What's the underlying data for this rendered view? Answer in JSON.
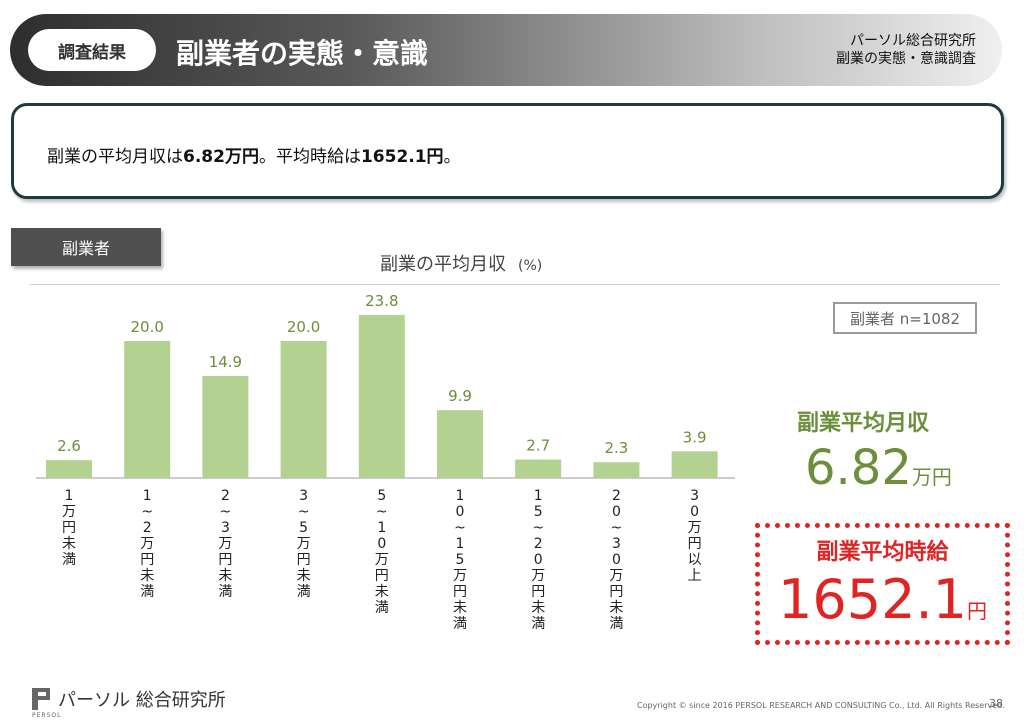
{
  "header": {
    "tag": "調査結果",
    "title": "副業者の実態・意識",
    "source_line1": "パーソル総合研究所",
    "source_line2": "副業の実態・意識調査"
  },
  "summary": {
    "prefix1": "副業の平均月収は",
    "value1": "6.82万円",
    "mid": "。平均時給は",
    "value2": "1652.1円",
    "suffix": "。"
  },
  "segment_label": "副業者",
  "sample_size": "副業者 n=1082",
  "avg_monthly": {
    "label": "副業平均月収",
    "value": "6.82",
    "unit": "万円"
  },
  "avg_hourly": {
    "label": "副業平均時給",
    "value": "1652.1",
    "unit": "円"
  },
  "footer": {
    "logo_text": "パーソル 総合研究所",
    "logo_sub": "PERSOL",
    "copyright": "Copyright © since 2016 PERSOL RESEARCH AND CONSULTING Co., Ltd. All Rights Reserved.",
    "page": "38"
  },
  "colors": {
    "bar": "#b3d190",
    "label": "#6b8f3a",
    "accent_red": "#e02424"
  },
  "chart_data": {
    "type": "bar",
    "title": "副業の平均月収",
    "unit": "(%)",
    "categories": [
      "1万円未満",
      "1~2万円未満",
      "2~3万円未満",
      "3~5万円未満",
      "5~10万円未満",
      "10~15万円未満",
      "15~20万円未満",
      "20~30万円未満",
      "30万円以上"
    ],
    "category_chars": [
      [
        "1",
        "万",
        "円",
        "未",
        "満"
      ],
      [
        "1",
        "~",
        "2",
        "万",
        "円",
        "未",
        "満"
      ],
      [
        "2",
        "~",
        "3",
        "万",
        "円",
        "未",
        "満"
      ],
      [
        "3",
        "~",
        "5",
        "万",
        "円",
        "未",
        "満"
      ],
      [
        "5",
        "~",
        "1",
        "0",
        "万",
        "円",
        "未",
        "満"
      ],
      [
        "1",
        "0",
        "~",
        "1",
        "5",
        "万",
        "円",
        "未",
        "満"
      ],
      [
        "1",
        "5",
        "~",
        "2",
        "0",
        "万",
        "円",
        "未",
        "満"
      ],
      [
        "2",
        "0",
        "~",
        "3",
        "0",
        "万",
        "円",
        "未",
        "満"
      ],
      [
        "3",
        "0",
        "万",
        "円",
        "以",
        "上"
      ]
    ],
    "values": [
      2.6,
      20.0,
      14.9,
      20.0,
      23.8,
      9.9,
      2.7,
      2.3,
      3.9
    ],
    "value_labels": [
      "2.6",
      "20.0",
      "14.9",
      "20.0",
      "23.8",
      "9.9",
      "2.7",
      "2.3",
      "3.9"
    ],
    "ylim": [
      0,
      25
    ],
    "grid": false,
    "legend": "none"
  }
}
